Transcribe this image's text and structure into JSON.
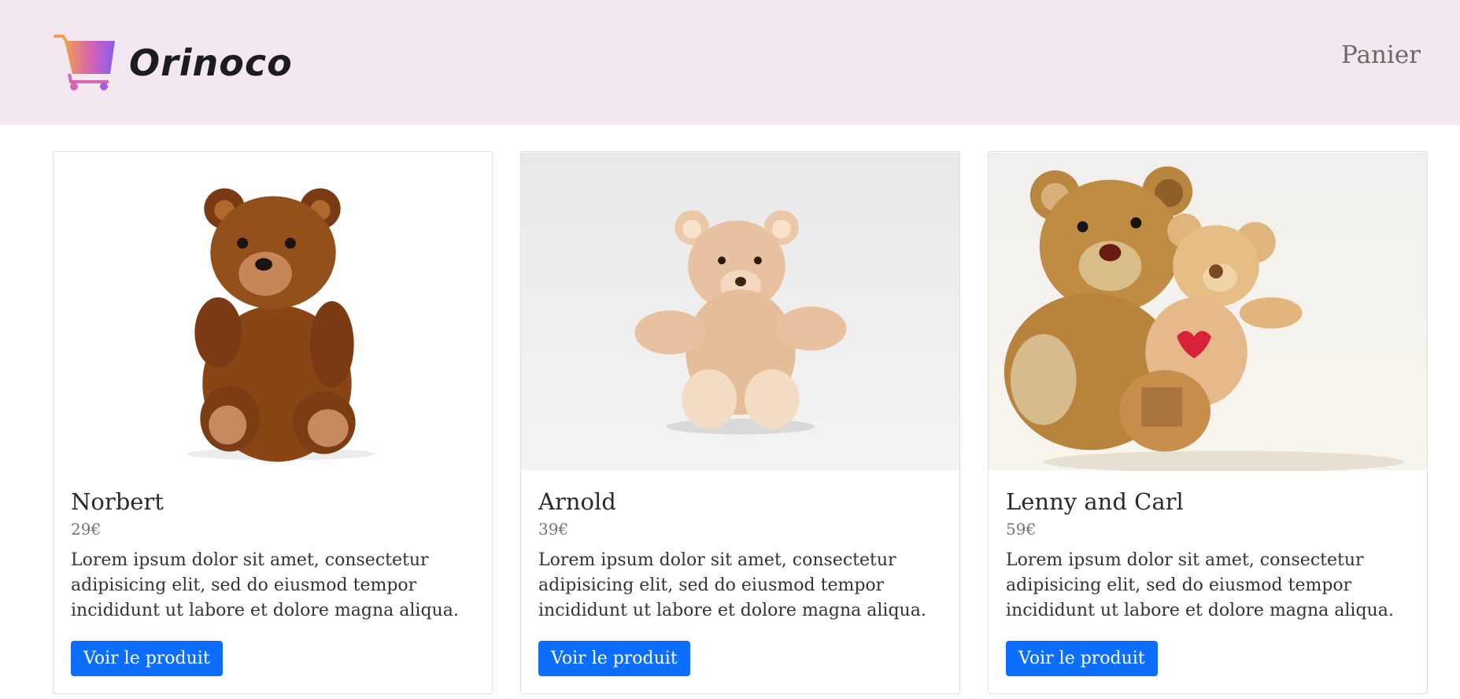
{
  "header": {
    "brand_name": "Orinoco",
    "nav_cart_label": "Panier"
  },
  "colors": {
    "header_bg": "#f3e7f0",
    "primary": "#0d6efd"
  },
  "products": [
    {
      "name": "Norbert",
      "price": "29€",
      "description": "Lorem ipsum dolor sit amet, consectetur adipisicing elit, sed do eiusmod tempor incididunt ut labore et dolore magna aliqua.",
      "button_label": "Voir le produit"
    },
    {
      "name": "Arnold",
      "price": "39€",
      "description": "Lorem ipsum dolor sit amet, consectetur adipisicing elit, sed do eiusmod tempor incididunt ut labore et dolore magna aliqua.",
      "button_label": "Voir le produit"
    },
    {
      "name": "Lenny and Carl",
      "price": "59€",
      "description": "Lorem ipsum dolor sit amet, consectetur adipisicing elit, sed do eiusmod tempor incididunt ut labore et dolore magna aliqua.",
      "button_label": "Voir le produit"
    }
  ]
}
